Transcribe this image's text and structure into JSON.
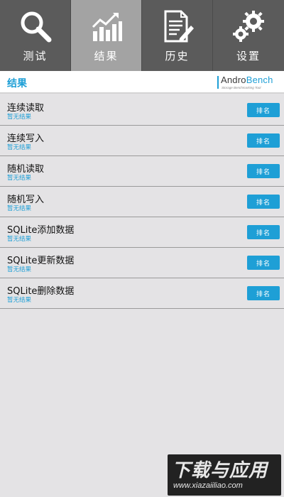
{
  "tabs": [
    {
      "label": "测试",
      "icon": "search-icon",
      "active": false
    },
    {
      "label": "结果",
      "icon": "chart-icon",
      "active": true
    },
    {
      "label": "历史",
      "icon": "document-edit-icon",
      "active": false
    },
    {
      "label": "设置",
      "icon": "gear-icon",
      "active": false
    }
  ],
  "header": {
    "title": "结果",
    "logo": {
      "andro": "Andro",
      "bench": "Bench",
      "tagline": "Storage Benchmarking Tool"
    }
  },
  "results": [
    {
      "title": "连续读取",
      "status": "暂无结果",
      "button": "排名"
    },
    {
      "title": "连续写入",
      "status": "暂无结果",
      "button": "排名"
    },
    {
      "title": "随机读取",
      "status": "暂无结果",
      "button": "排名"
    },
    {
      "title": "随机写入",
      "status": "暂无结果",
      "button": "排名"
    },
    {
      "title": "SQLite添加数据",
      "status": "暂无结果",
      "button": "排名"
    },
    {
      "title": "SQLite更新数据",
      "status": "暂无结果",
      "button": "排名"
    },
    {
      "title": "SQLite删除数据",
      "status": "暂无结果",
      "button": "排名"
    }
  ],
  "watermark": {
    "brand": "下载与应用",
    "url": "www.xiazaiiliao.com"
  },
  "colors": {
    "accent": "#1e9fd6",
    "tab_bg": "#5b5b5b",
    "tab_active": "#a3a3a3",
    "page_bg": "#e4e3e5"
  }
}
